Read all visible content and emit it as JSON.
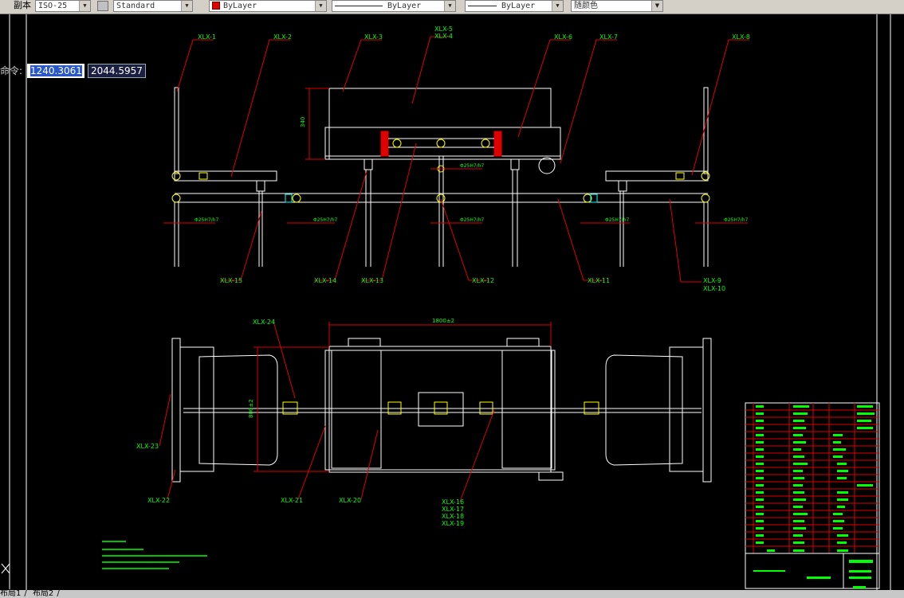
{
  "toolbar": {
    "dimstyle_prefix": "副本",
    "dimstyle_value": "ISO-25",
    "textstyle_value": "Standard",
    "layer_value": "ByLayer",
    "linetype_value": "ByLayer",
    "lineweight_value": "ByLayer",
    "plotstyle_value": "随颜色"
  },
  "command": {
    "label": "命令:",
    "x_value": "1240.3061",
    "y_value": "2044.5957"
  },
  "callouts": {
    "top": [
      "XLX-1",
      "XLX-2",
      "XLX-3",
      "XLX-5",
      "XLX-4",
      "XLX-6",
      "XLX-7",
      "XLX-8"
    ],
    "mid": [
      "XLX-15",
      "XLX-14",
      "XLX-13",
      "XLX-12",
      "XLX-11",
      "XLX-9",
      "XLX-10"
    ],
    "bottom": [
      "XLX-24",
      "XLX-23",
      "XLX-22",
      "XLX-21",
      "XLX-20",
      "XLX-16",
      "XLX-17",
      "XLX-18",
      "XLX-19"
    ]
  },
  "dims": {
    "width_overall": "1800±2",
    "height_plan": "800±2",
    "height_front": "340",
    "fit": "Φ25H7/h7"
  },
  "tabs": [
    "布局1",
    "布局2"
  ]
}
